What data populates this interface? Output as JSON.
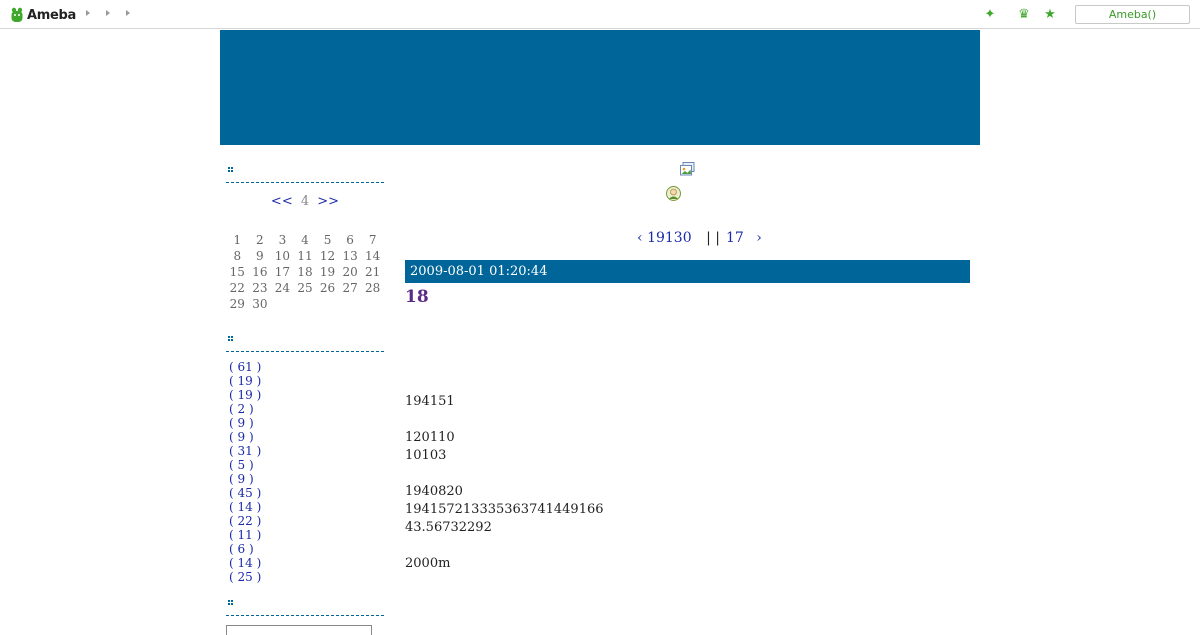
{
  "topbar": {
    "logo_text": "Ameba",
    "login_label": "Ameba()",
    "icons": [
      "sparkle-icon",
      "crown-icon",
      "star-icon"
    ]
  },
  "colors": {
    "header_blue": "#006699",
    "link_blue": "#1a2aa8",
    "title_purple": "#5b2a86",
    "ameba_green": "#3ea82c"
  },
  "calendar": {
    "prev": "<<",
    "month": "4",
    "next": ">>",
    "rows": [
      [
        "1",
        "2",
        "3",
        "4",
        "5",
        "6",
        "7"
      ],
      [
        "8",
        "9",
        "10",
        "11",
        "12",
        "13",
        "14"
      ],
      [
        "15",
        "16",
        "17",
        "18",
        "19",
        "20",
        "21"
      ],
      [
        "22",
        "23",
        "24",
        "25",
        "26",
        "27",
        "28"
      ],
      [
        "29",
        "30",
        "",
        "",
        "",
        "",
        ""
      ]
    ]
  },
  "categories": [
    "( 61 )",
    "( 19 )",
    "( 19 )",
    "( 2 )",
    "( 9 )",
    "( 9 )",
    "( 31 )",
    "( 5 )",
    "( 9 )",
    "( 45 )",
    "( 14 )",
    "( 22 )",
    "( 11 )",
    "( 6 )",
    "( 14 )",
    "( 25 )"
  ],
  "pager": {
    "prev_label": "19130",
    "sep": "| |",
    "next_label": "17"
  },
  "entry": {
    "date": "2009-08-01 01:20:44",
    "title": "18",
    "lines": [
      "194151",
      "",
      "120110",
      "10103",
      "",
      "1940820",
      "19415721333536374144916​6",
      "43.56732292",
      "",
      "2000m"
    ]
  }
}
